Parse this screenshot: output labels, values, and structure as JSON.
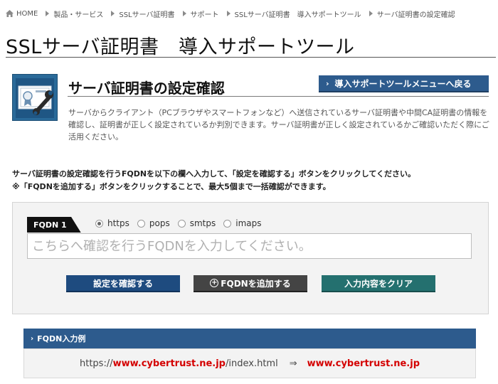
{
  "breadcrumb": {
    "items": [
      "HOME",
      "製品・サービス",
      "SSLサーバ証明書",
      "サポート",
      "SSLサーバ証明書　導入サポートツール",
      "サーバ証明書の設定確認"
    ]
  },
  "page": {
    "title": "SSLサーバ証明書　導入サポートツール"
  },
  "section": {
    "heading": "サーバ証明書の設定確認",
    "back_button": "導入サポートツールメニューへ戻る",
    "description": "サーバからクライアント（PCブラウザやスマートフォンなど）へ送信されているサーバ証明書や中間CA証明書の情報を確認し、証明書が正しく設定されているか判別できます。サーバ証明書が正しく設定されているかご確認いただく際にご活用ください。",
    "icon": "certificate-wrench-icon"
  },
  "instructions": {
    "line1": "サーバ証明書の設定確認を行うFQDNを以下の欄へ入力して、「設定を確認する」ボタンをクリックしてください。",
    "line2": "※「FQDNを追加する」ボタンをクリックすることで、最大5個まで一括確認ができます。"
  },
  "form": {
    "fqdn_label": "FQDN 1",
    "protocols": [
      "https",
      "pops",
      "smtps",
      "imaps"
    ],
    "selected_protocol": "https",
    "input_value": "",
    "input_placeholder": "こちらへ確認を行うFQDNを入力してください。",
    "confirm_button": "設定を確認する",
    "add_button": "FQDNを追加する",
    "clear_button": "入力内容をクリア"
  },
  "example": {
    "title": "FQDN入力例",
    "url_prefix": "https://",
    "url_host": "www.cybertrust.ne.jp",
    "url_path": "/index.html",
    "arrow": "⇒",
    "result": "www.cybertrust.ne.jp"
  },
  "colors": {
    "nav_blue": "#2d5b8d",
    "confirm_blue": "#1e4b7f",
    "add_gray": "#444444",
    "clear_teal": "#24706f",
    "highlight_red": "#d40000"
  }
}
